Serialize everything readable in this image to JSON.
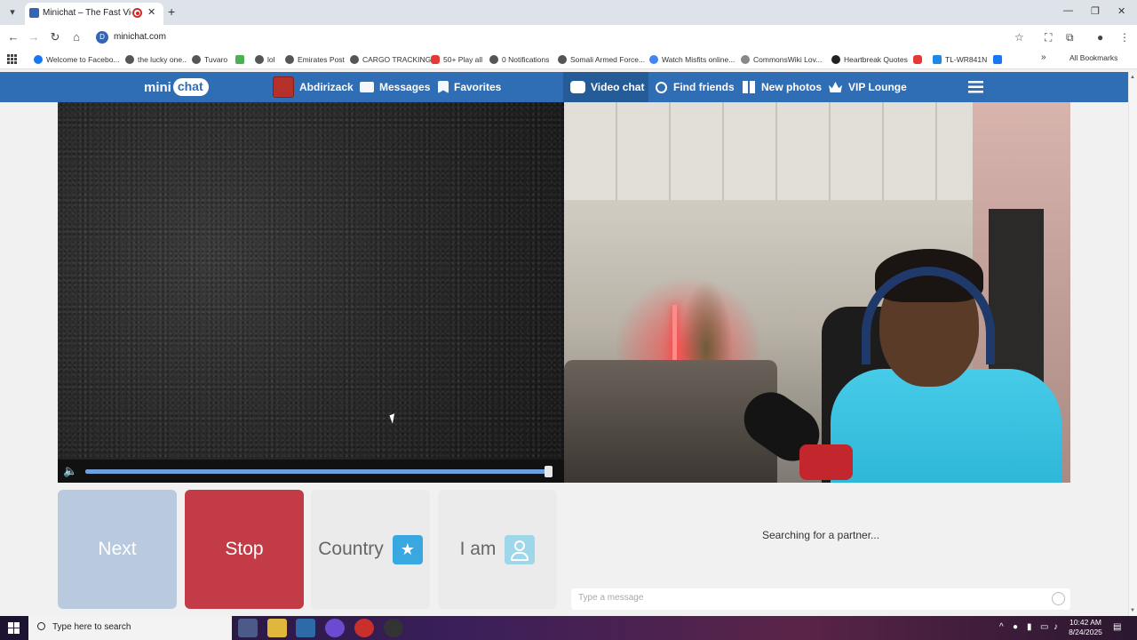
{
  "browser": {
    "tab_title": "Minichat – The Fast Video C",
    "url": "minichat.com",
    "bookmarks": [
      "Welcome to Facebo...",
      "the lucky one..",
      "Tuvaro",
      "lol",
      "Emirates Post",
      "CARGO TRACKING",
      "50+ Play all",
      "0 Notifications",
      "Somali Armed Force...",
      "Watch Misfits online...",
      "CommonsWiki Lov...",
      "Heartbreak Quotes",
      "TL-WR841N"
    ],
    "all_bookmarks": "All Bookmarks"
  },
  "site": {
    "logo_mini": "mini",
    "logo_chat": "chat",
    "user_name": "Abdirizack",
    "messages": "Messages",
    "favorites": "Favorites",
    "video_chat": "Video chat",
    "find_friends": "Find friends",
    "new_photos": "New photos",
    "vip_lounge": "VIP Lounge"
  },
  "player": {
    "volume_level": 1.0
  },
  "controls": {
    "next": "Next",
    "stop": "Stop",
    "country": "Country",
    "i_am": "I am"
  },
  "chat": {
    "status": "Searching for a partner...",
    "placeholder": "Type a message"
  },
  "taskbar": {
    "search_placeholder": "Type here to search",
    "time": "10:42 AM",
    "date": "8/24/2025"
  },
  "colors": {
    "brand_blue": "#2f6eb4",
    "next_bg": "#b9cadf",
    "stop_bg": "#c23b47"
  }
}
